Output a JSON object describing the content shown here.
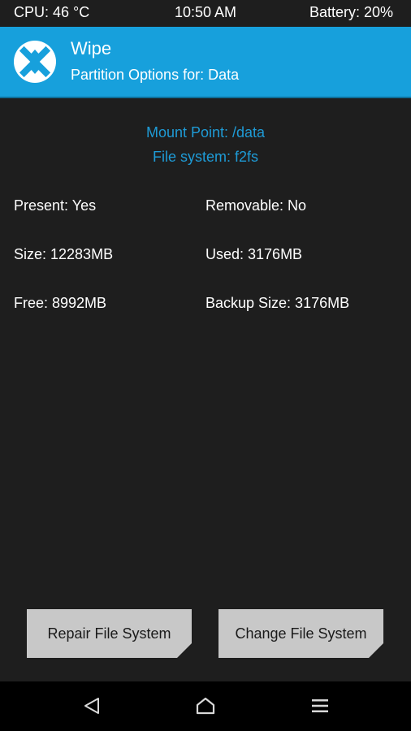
{
  "status_bar": {
    "cpu": "CPU: 46 °C",
    "time": "10:50 AM",
    "battery": "Battery: 20%"
  },
  "header": {
    "title": "Wipe",
    "subtitle": "Partition Options for: Data",
    "logo_icon": "twrp-logo-icon"
  },
  "partition": {
    "mount_point": "Mount Point: /data",
    "file_system": "File system: f2fs",
    "present": "Present: Yes",
    "removable": "Removable: No",
    "size": "Size: 12283MB",
    "used": "Used: 3176MB",
    "free": "Free: 8992MB",
    "backup_size": "Backup Size: 3176MB"
  },
  "actions": {
    "repair_label": "Repair File System",
    "change_label": "Change File System"
  },
  "nav_bar": {
    "back_icon": "back-triangle-icon",
    "home_icon": "home-icon",
    "menu_icon": "menu-lines-icon"
  },
  "colors": {
    "accent": "#17a0dc",
    "accent_text": "#1e9bd6",
    "background": "#1e1e1e",
    "button": "#c8c8c8",
    "nav_bar": "#000000"
  }
}
